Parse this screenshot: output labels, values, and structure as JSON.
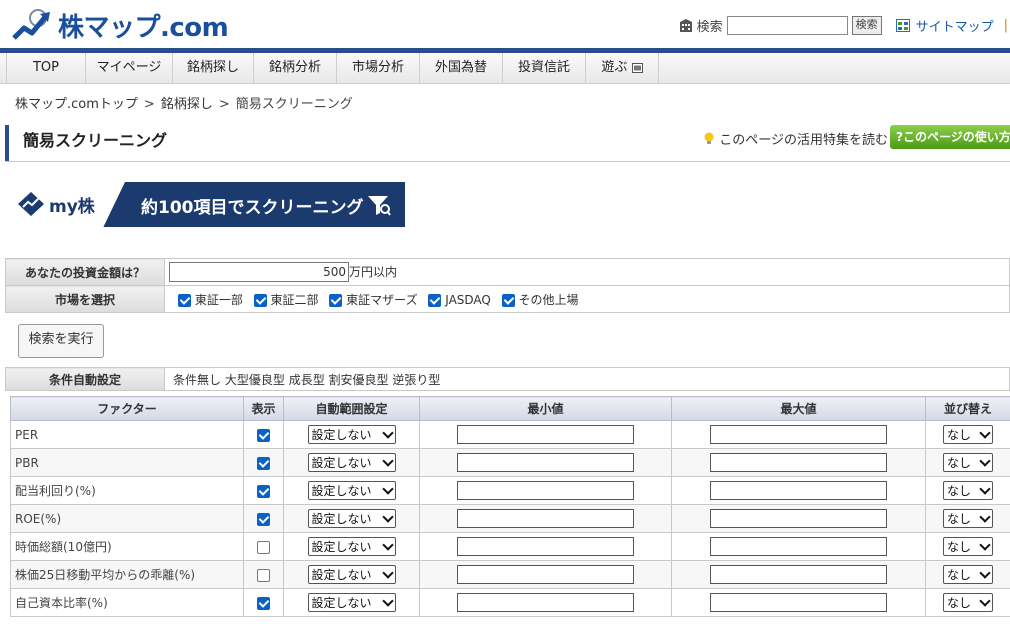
{
  "header": {
    "logo_main": "株マップ",
    "logo_domain": ".com",
    "search_label": "検索",
    "search_value": "",
    "search_button": "検索",
    "sitemap": "サイトマップ",
    "separator": "|"
  },
  "nav": {
    "items": [
      "TOP",
      "マイページ",
      "銘柄探し",
      "銘柄分析",
      "市場分析",
      "外国為替",
      "投資信託",
      "遊ぶ"
    ]
  },
  "breadcrumb": [
    "株マップ.comトップ",
    "銘柄探し",
    "簡易スクリーニング"
  ],
  "breadcrumb_sep": ">",
  "page": {
    "title": "簡易スクリーニング",
    "tip": "このページの活用特集を読む",
    "howto": "?このページの使い方"
  },
  "banner": {
    "brand": "my株",
    "text": "約100項目でスクリーニング"
  },
  "form": {
    "amount_label": "あなたの投資金額は？",
    "amount_value": "500",
    "amount_unit": "万円以内",
    "market_label": "市場を選択",
    "markets": [
      {
        "label": "東証一部",
        "checked": true
      },
      {
        "label": "東証二部",
        "checked": true
      },
      {
        "label": "東証マザーズ",
        "checked": true
      },
      {
        "label": "JASDAQ",
        "checked": true
      },
      {
        "label": "その他上場",
        "checked": true
      }
    ],
    "execute": "検索を実行"
  },
  "auto": {
    "label": "条件自動設定",
    "options": [
      "条件無し",
      "大型優良型",
      "成長型",
      "割安優良型",
      "逆張り型"
    ]
  },
  "factors": {
    "headers": [
      "ファクター",
      "表示",
      "自動範囲設定",
      "最小値",
      "最大値",
      "並び替え"
    ],
    "select_default": "設定しない",
    "sort_default": "なし",
    "rows": [
      {
        "name": "PER",
        "checked": true
      },
      {
        "name": "PBR",
        "checked": true
      },
      {
        "name": "配当利回り(%)",
        "checked": true
      },
      {
        "name": "ROE(%)",
        "checked": true
      },
      {
        "name": "時価総額(10億円)",
        "checked": false
      },
      {
        "name": "株価25日移動平均からの乖離(%)",
        "checked": false
      },
      {
        "name": "自己資本比率(%)",
        "checked": true
      }
    ]
  },
  "colors": {
    "brand_blue": "#2a4d8e",
    "checkbox_blue": "#0a62c9",
    "howto_green": "#4a9a17"
  }
}
